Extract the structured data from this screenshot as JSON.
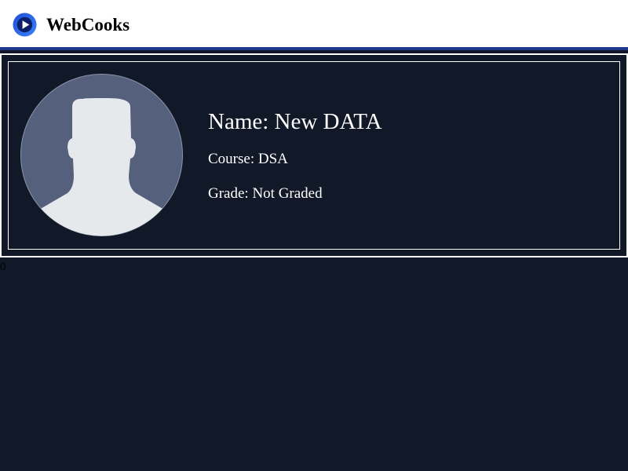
{
  "header": {
    "brand": "WebCooks",
    "logo_icon": "play-circle-icon"
  },
  "profile": {
    "avatar_icon": "user-avatar-placeholder-icon",
    "name_label": "Name: New DATA",
    "course_label": "Course: DSA",
    "grade_label": "Grade: Not Graded"
  },
  "counter": "0",
  "colors": {
    "background": "#111827",
    "navbar": "#ffffff",
    "navbar_border": "#1e3a8a",
    "logo_blue": "#2563eb",
    "avatar_bg": "#55607d",
    "avatar_figure": "#e5e9ec"
  }
}
